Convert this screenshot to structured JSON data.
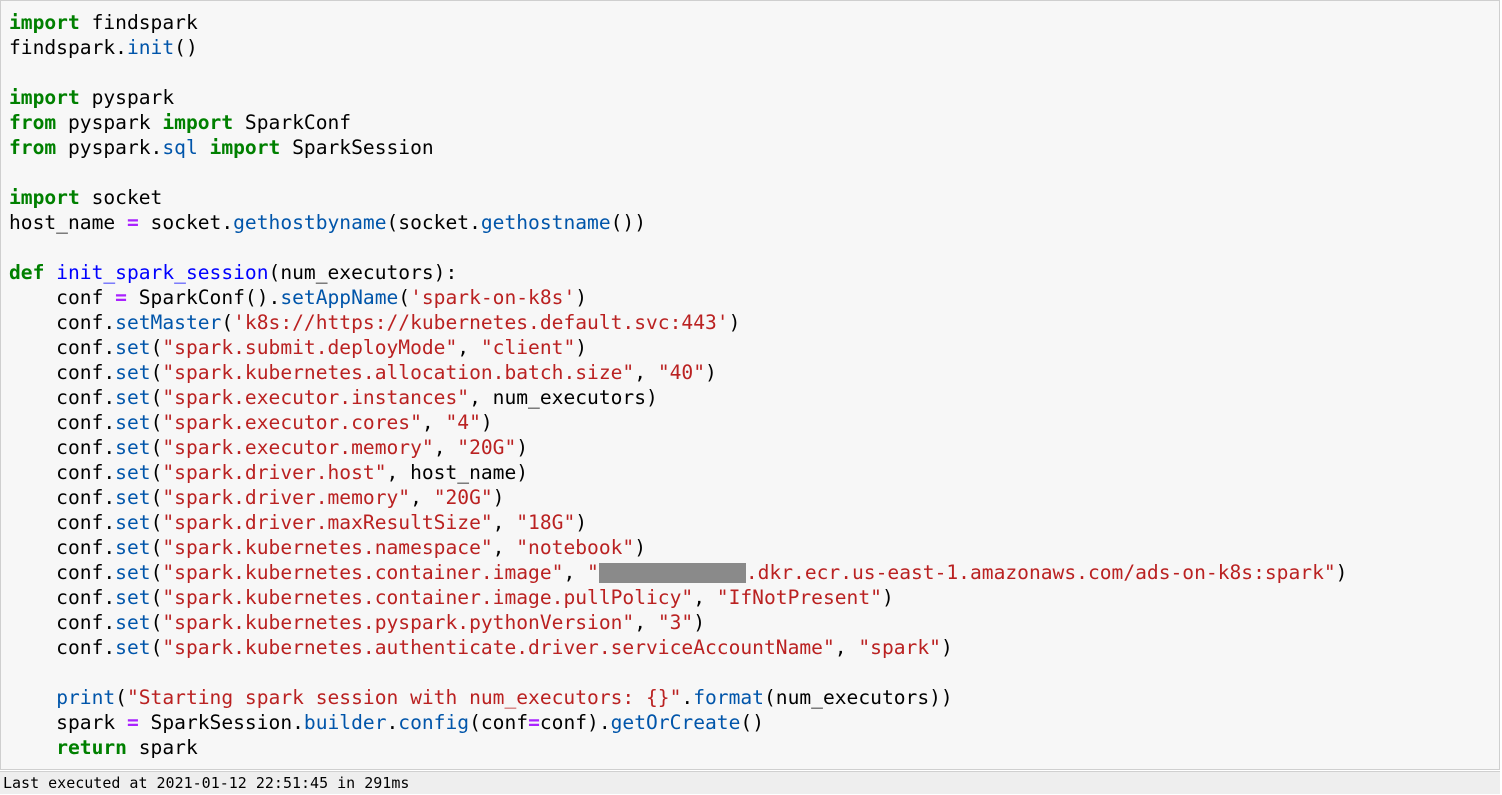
{
  "code_lines": [
    [
      {
        "t": "import",
        "c": "kw"
      },
      {
        "t": " findspark"
      }
    ],
    [
      {
        "t": "findspark."
      },
      {
        "t": "init",
        "c": "nm"
      },
      {
        "t": "()"
      }
    ],
    [],
    [
      {
        "t": "import",
        "c": "kw"
      },
      {
        "t": " pyspark"
      }
    ],
    [
      {
        "t": "from",
        "c": "kw"
      },
      {
        "t": " pyspark "
      },
      {
        "t": "import",
        "c": "kw"
      },
      {
        "t": " SparkConf"
      }
    ],
    [
      {
        "t": "from",
        "c": "kw"
      },
      {
        "t": " pyspark."
      },
      {
        "t": "sql",
        "c": "nm"
      },
      {
        "t": " "
      },
      {
        "t": "import",
        "c": "kw"
      },
      {
        "t": " SparkSession"
      }
    ],
    [],
    [
      {
        "t": "import",
        "c": "kw"
      },
      {
        "t": " socket"
      }
    ],
    [
      {
        "t": "host_name "
      },
      {
        "t": "=",
        "c": "op"
      },
      {
        "t": " socket."
      },
      {
        "t": "gethostbyname",
        "c": "nm"
      },
      {
        "t": "(socket."
      },
      {
        "t": "gethostname",
        "c": "nm"
      },
      {
        "t": "())"
      }
    ],
    [],
    [
      {
        "t": "def",
        "c": "kw"
      },
      {
        "t": " "
      },
      {
        "t": "init_spark_session",
        "c": "fn"
      },
      {
        "t": "(num_executors):"
      }
    ],
    [
      {
        "t": "    conf "
      },
      {
        "t": "=",
        "c": "op"
      },
      {
        "t": " SparkConf()."
      },
      {
        "t": "setAppName",
        "c": "nm"
      },
      {
        "t": "("
      },
      {
        "t": "'spark-on-k8s'",
        "c": "st"
      },
      {
        "t": ")"
      }
    ],
    [
      {
        "t": "    conf."
      },
      {
        "t": "setMaster",
        "c": "nm"
      },
      {
        "t": "("
      },
      {
        "t": "'k8s://https://kubernetes.default.svc:443'",
        "c": "st"
      },
      {
        "t": ")"
      }
    ],
    [
      {
        "t": "    conf."
      },
      {
        "t": "set",
        "c": "nm"
      },
      {
        "t": "("
      },
      {
        "t": "\"spark.submit.deployMode\"",
        "c": "st"
      },
      {
        "t": ", "
      },
      {
        "t": "\"client\"",
        "c": "st"
      },
      {
        "t": ")"
      }
    ],
    [
      {
        "t": "    conf."
      },
      {
        "t": "set",
        "c": "nm"
      },
      {
        "t": "("
      },
      {
        "t": "\"spark.kubernetes.allocation.batch.size\"",
        "c": "st"
      },
      {
        "t": ", "
      },
      {
        "t": "\"40\"",
        "c": "st"
      },
      {
        "t": ")"
      }
    ],
    [
      {
        "t": "    conf."
      },
      {
        "t": "set",
        "c": "nm"
      },
      {
        "t": "("
      },
      {
        "t": "\"spark.executor.instances\"",
        "c": "st"
      },
      {
        "t": ", num_executors)"
      }
    ],
    [
      {
        "t": "    conf."
      },
      {
        "t": "set",
        "c": "nm"
      },
      {
        "t": "("
      },
      {
        "t": "\"spark.executor.cores\"",
        "c": "st"
      },
      {
        "t": ", "
      },
      {
        "t": "\"4\"",
        "c": "st"
      },
      {
        "t": ")"
      }
    ],
    [
      {
        "t": "    conf."
      },
      {
        "t": "set",
        "c": "nm"
      },
      {
        "t": "("
      },
      {
        "t": "\"spark.executor.memory\"",
        "c": "st"
      },
      {
        "t": ", "
      },
      {
        "t": "\"20G\"",
        "c": "st"
      },
      {
        "t": ")"
      }
    ],
    [
      {
        "t": "    conf."
      },
      {
        "t": "set",
        "c": "nm"
      },
      {
        "t": "("
      },
      {
        "t": "\"spark.driver.host\"",
        "c": "st"
      },
      {
        "t": ", host_name)"
      }
    ],
    [
      {
        "t": "    conf."
      },
      {
        "t": "set",
        "c": "nm"
      },
      {
        "t": "("
      },
      {
        "t": "\"spark.driver.memory\"",
        "c": "st"
      },
      {
        "t": ", "
      },
      {
        "t": "\"20G\"",
        "c": "st"
      },
      {
        "t": ")"
      }
    ],
    [
      {
        "t": "    conf."
      },
      {
        "t": "set",
        "c": "nm"
      },
      {
        "t": "("
      },
      {
        "t": "\"spark.driver.maxResultSize\"",
        "c": "st"
      },
      {
        "t": ", "
      },
      {
        "t": "\"18G\"",
        "c": "st"
      },
      {
        "t": ")"
      }
    ],
    [
      {
        "t": "    conf."
      },
      {
        "t": "set",
        "c": "nm"
      },
      {
        "t": "("
      },
      {
        "t": "\"spark.kubernetes.namespace\"",
        "c": "st"
      },
      {
        "t": ", "
      },
      {
        "t": "\"notebook\"",
        "c": "st"
      },
      {
        "t": ")"
      }
    ],
    [
      {
        "t": "    conf."
      },
      {
        "t": "set",
        "c": "nm"
      },
      {
        "t": "("
      },
      {
        "t": "\"spark.kubernetes.container.image\"",
        "c": "st"
      },
      {
        "t": ", "
      },
      {
        "t": "\"",
        "c": "st"
      },
      {
        "redact": true
      },
      {
        "t": ".dkr.ecr.us-east-1.amazonaws.com/ads-on-k8s:spark\"",
        "c": "st"
      },
      {
        "t": ")"
      }
    ],
    [
      {
        "t": "    conf."
      },
      {
        "t": "set",
        "c": "nm"
      },
      {
        "t": "("
      },
      {
        "t": "\"spark.kubernetes.container.image.pullPolicy\"",
        "c": "st"
      },
      {
        "t": ", "
      },
      {
        "t": "\"IfNotPresent\"",
        "c": "st"
      },
      {
        "t": ")"
      }
    ],
    [
      {
        "t": "    conf."
      },
      {
        "t": "set",
        "c": "nm"
      },
      {
        "t": "("
      },
      {
        "t": "\"spark.kubernetes.pyspark.pythonVersion\"",
        "c": "st"
      },
      {
        "t": ", "
      },
      {
        "t": "\"3\"",
        "c": "st"
      },
      {
        "t": ")"
      }
    ],
    [
      {
        "t": "    conf."
      },
      {
        "t": "set",
        "c": "nm"
      },
      {
        "t": "("
      },
      {
        "t": "\"spark.kubernetes.authenticate.driver.serviceAccountName\"",
        "c": "st"
      },
      {
        "t": ", "
      },
      {
        "t": "\"spark\"",
        "c": "st"
      },
      {
        "t": ")"
      }
    ],
    [],
    [
      {
        "t": "    "
      },
      {
        "t": "print",
        "c": "nm"
      },
      {
        "t": "("
      },
      {
        "t": "\"Starting spark session with num_executors: {}\"",
        "c": "st"
      },
      {
        "t": "."
      },
      {
        "t": "format",
        "c": "nm"
      },
      {
        "t": "(num_executors))"
      }
    ],
    [
      {
        "t": "    spark "
      },
      {
        "t": "=",
        "c": "op"
      },
      {
        "t": " SparkSession."
      },
      {
        "t": "builder",
        "c": "nm"
      },
      {
        "t": "."
      },
      {
        "t": "config",
        "c": "nm"
      },
      {
        "t": "(conf"
      },
      {
        "t": "=",
        "c": "op"
      },
      {
        "t": "conf)."
      },
      {
        "t": "getOrCreate",
        "c": "nm"
      },
      {
        "t": "()"
      }
    ],
    [
      {
        "t": "    "
      },
      {
        "t": "return",
        "c": "kw"
      },
      {
        "t": " spark"
      }
    ]
  ],
  "status": {
    "text": "Last executed at 2021-01-12 22:51:45 in 291ms"
  }
}
